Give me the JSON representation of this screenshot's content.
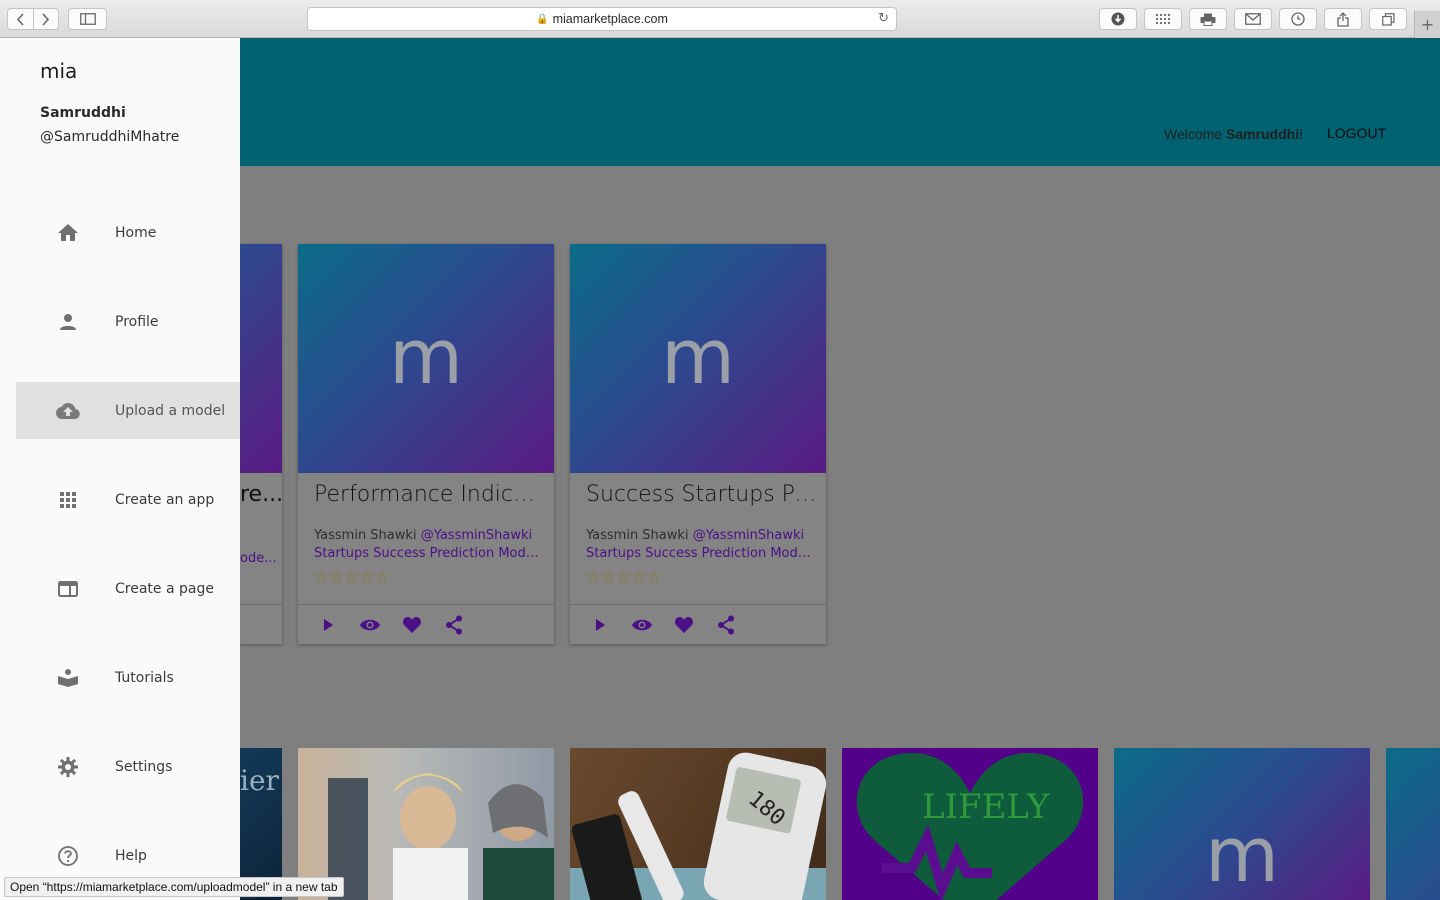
{
  "browser": {
    "url": "miamarketplace.com",
    "status_text": "Open “https://miamarketplace.com/uploadmodel” in a new tab"
  },
  "header": {
    "welcome_prefix": "Welcome ",
    "welcome_user": "Samruddhi",
    "welcome_suffix": "!",
    "logout_label": "LOGOUT"
  },
  "drawer": {
    "brand": "mia",
    "user_name": "Samruddhi",
    "user_handle": "@SamruddhiMhatre",
    "items": [
      {
        "label": "Home",
        "icon": "home-icon"
      },
      {
        "label": "Profile",
        "icon": "person-icon"
      },
      {
        "label": "Upload a model",
        "icon": "cloud-upload-icon",
        "active": true
      },
      {
        "label": "Create an app",
        "icon": "apps-grid-icon"
      },
      {
        "label": "Create a page",
        "icon": "web-page-icon"
      },
      {
        "label": "Tutorials",
        "icon": "book-icon"
      },
      {
        "label": "Settings",
        "icon": "gear-icon"
      },
      {
        "label": "Help",
        "icon": "help-circle-icon"
      }
    ]
  },
  "cards": [
    {
      "letter": "m",
      "title": "Performance Indicat...",
      "author": "Yassmin Shawki",
      "handle": "@YassminShawki",
      "description": "Startups Success Prediction Mode...",
      "stars": "☆☆☆☆☆"
    },
    {
      "letter": "m",
      "title": "Success Startups Pre...",
      "author": "Yassmin Shawki",
      "handle": "@YassminShawki",
      "description": "Startups Success Prediction Mode...",
      "stars": "☆☆☆☆☆"
    }
  ],
  "partial_card": {
    "title_fragment": "re...",
    "desc_fragment": "ode..."
  },
  "tiles": {
    "tile_a_fragment": "ier",
    "lifely_text": "LIFELY",
    "glucometer_reading": "180",
    "tile_e_letter": "m"
  },
  "colors": {
    "appbar": "#006270",
    "accent_purple": "#4b0f86",
    "drawer_bg": "#fafafa"
  }
}
